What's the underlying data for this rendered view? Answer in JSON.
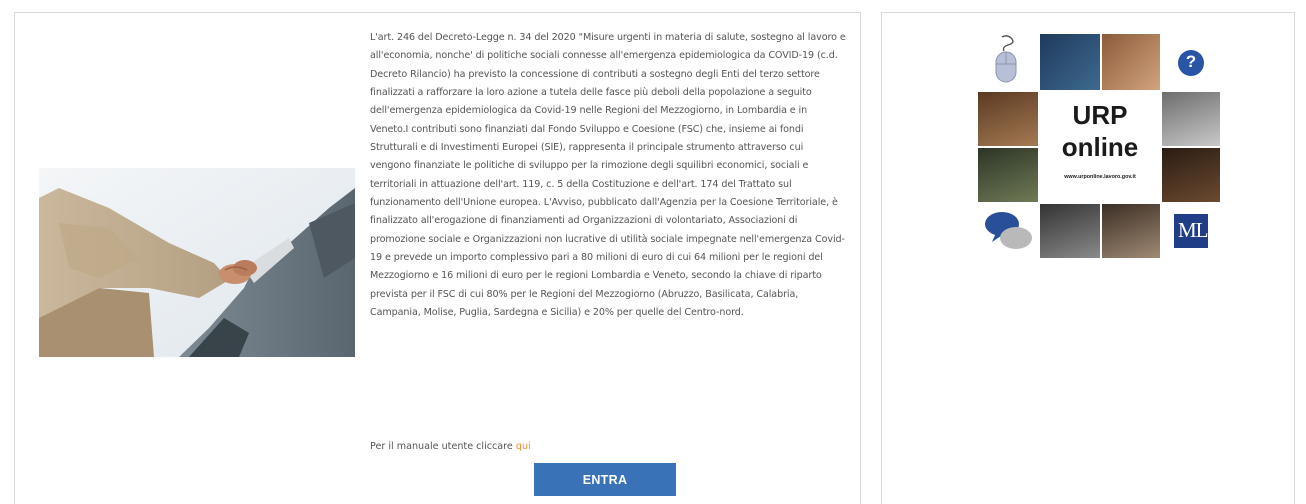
{
  "main": {
    "body": "L'art. 246 del Decreto-Legge n. 34 del 2020 \"Misure urgenti in materia di salute, sostegno al lavoro e all'economia, nonche' di politiche sociali connesse all'emergenza epidemiologica da COVID-19 (c.d. Decreto Rilancio) ha previsto la concessione di contributi a sostegno degli Enti del terzo settore finalizzati a rafforzare la loro azione a tutela delle fasce più deboli della popolazione a seguito dell'emergenza epidemiologica da Covid-19 nelle Regioni del Mezzogiorno, in Lombardia e in Veneto.I contributi sono finanziati dal Fondo Sviluppo e Coesione (FSC) che, insieme ai fondi Strutturali e di Investimenti Europei (SIE), rappresenta il principale strumento attraverso cui vengono finanziate le politiche di sviluppo per la rimozione degli squilibri economici, sociali e territoriali in attuazione dell'art. 119, c. 5 della Costituzione e dell'art. 174 del Trattato sul funzionamento dell'Unione europea. L'Avviso, pubblicato dall'Agenzia per la Coesione Territoriale, è finalizzato all'erogazione di finanziamenti ad Organizzazioni di volontariato, Associazioni di promozione sociale e Organizzazioni non lucrative di utilità sociale impegnate nell'emergenza Covid-19 e prevede un importo complessivo pari a 80 milioni di euro di cui 64 milioni per le regioni del Mezzogiorno e 16 milioni di euro per le regioni Lombardia e Veneto, secondo la chiave di riparto prevista per il FSC di cui 80% per le Regioni del Mezzogiorno (Abruzzo, Basilicata, Calabria, Campania, Molise, Puglia, Sardegna e Sicilia) e 20% per quelle del Centro-nord.",
    "manual_prefix": "Per il manuale utente cliccare ",
    "manual_link": "qui",
    "button_label": "ENTRA"
  },
  "urp": {
    "title_line1": "URP",
    "title_line2": "online",
    "url": "www.urponline.lavoro.gov.it",
    "logo_text": "ML",
    "question_mark": "?"
  }
}
